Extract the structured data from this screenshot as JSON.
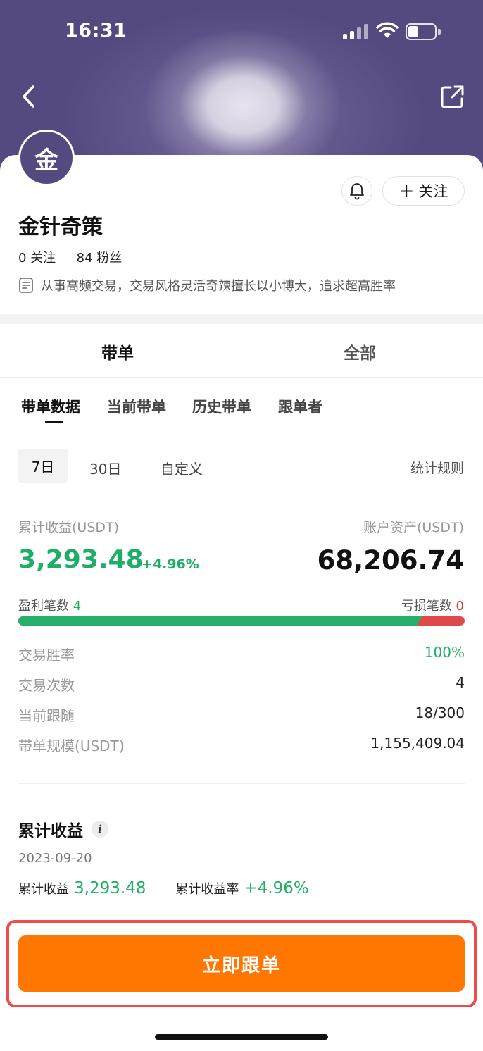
{
  "status_bar": {
    "time": "16:31"
  },
  "profile": {
    "avatar_letter": "金",
    "name": "金针奇策",
    "following_count": "0",
    "following_label": "关注",
    "fans_count": "84",
    "fans_label": "粉丝",
    "bio": "从事高频交易，交易风格灵活奇辣擅长以小博大，追求超高胜率",
    "follow_button": "关注"
  },
  "main_tabs": [
    {
      "label": "带单",
      "active": true
    },
    {
      "label": "全部",
      "active": false
    }
  ],
  "sub_tabs": [
    {
      "label": "带单数据",
      "active": true
    },
    {
      "label": "当前带单",
      "active": false
    },
    {
      "label": "历史带单",
      "active": false
    },
    {
      "label": "跟单者",
      "active": false
    }
  ],
  "periods": [
    {
      "label": "7日",
      "active": true
    },
    {
      "label": "30日",
      "active": false
    },
    {
      "label": "自定义",
      "active": false
    }
  ],
  "rules_link": "统计规则",
  "metrics": {
    "cumulative_label": "累计收益(USDT)",
    "cumulative_value": "3,293.48",
    "cumulative_pct": "+4.96%",
    "assets_label": "账户资产(USDT)",
    "assets_value": "68,206.74",
    "win_label": "盈利笔数",
    "win_count": "4",
    "loss_label": "亏损笔数",
    "loss_count": "0",
    "win_ratio": 0.905
  },
  "stats": [
    {
      "key": "交易胜率",
      "value": "100%",
      "highlight": true
    },
    {
      "key": "交易次数",
      "value": "4",
      "highlight": false
    },
    {
      "key": "当前跟随",
      "value": "18/300",
      "highlight": false
    },
    {
      "key": "带单规模(USDT)",
      "value": "1,155,409.04",
      "highlight": false
    }
  ],
  "earnings_section": {
    "title": "累计收益",
    "date": "2023-09-20",
    "sum_label": "累计收益",
    "sum_value": "3,293.48",
    "rate_label": "累计收益率",
    "rate_value": "+4.96%"
  },
  "cta": {
    "label": "立即跟单"
  },
  "colors": {
    "banner": "#544a80",
    "green": "#1fae68",
    "red": "#e03b3b",
    "cta": "#ff7700",
    "highlight_frame": "#ef4b4b"
  }
}
